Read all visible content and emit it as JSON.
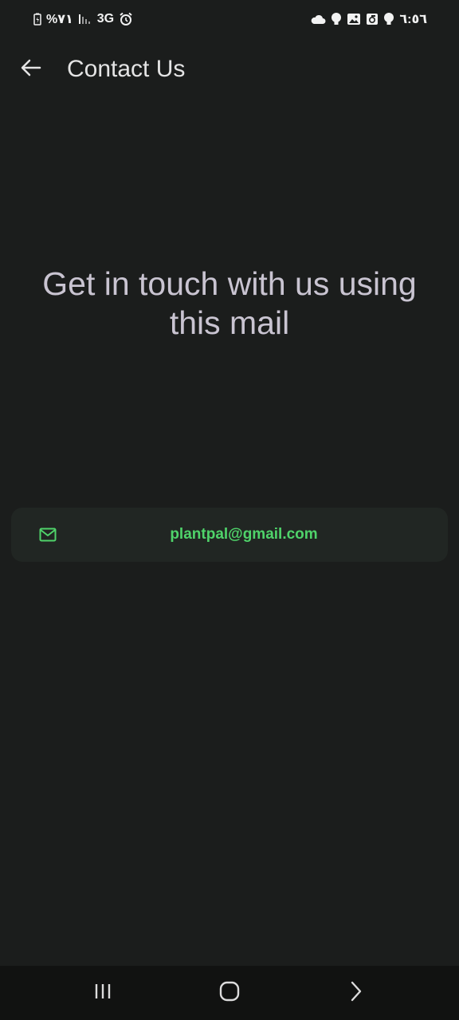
{
  "status_bar": {
    "battery_text": "%٧١",
    "network_text": "3G",
    "time": "٦:٥٦",
    "icons": [
      "battery-icon",
      "signal-icon",
      "alarm-icon",
      "cloud-icon",
      "bulb-icon",
      "image-icon",
      "save-icon",
      "bulb-icon"
    ]
  },
  "app_bar": {
    "title": "Contact Us",
    "back_icon": "arrow-left-icon"
  },
  "main": {
    "headline": "Get in touch with us using this mail",
    "email": "plantpal@gmail.com",
    "email_icon": "mail-icon"
  },
  "nav_bar": {
    "icons": [
      "recent-apps-icon",
      "home-icon",
      "back-icon"
    ]
  },
  "colors": {
    "background": "#1b1d1c",
    "accent": "#4fd36a",
    "card": "#212623",
    "headline": "#c9c4d1"
  }
}
